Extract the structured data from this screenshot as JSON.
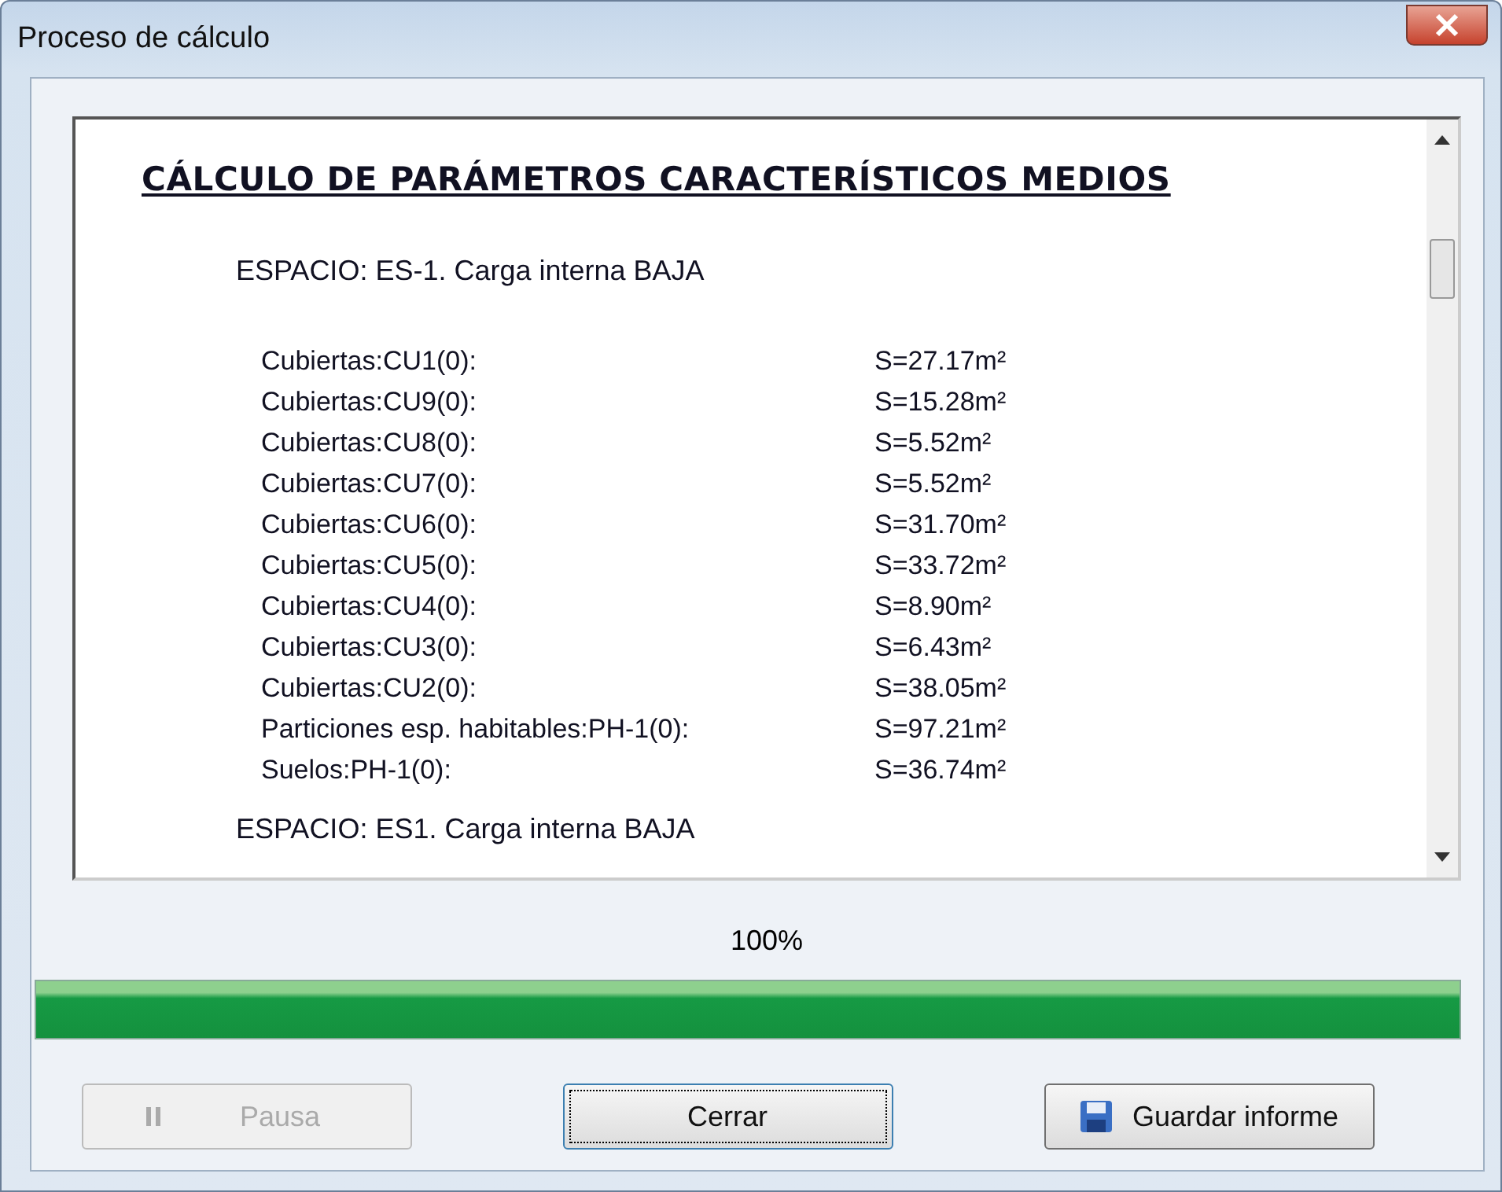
{
  "window": {
    "title": "Proceso de cálculo"
  },
  "report": {
    "heading": "CÁLCULO DE PARÁMETROS CARACTERÍSTICOS MEDIOS",
    "sections": [
      {
        "title": "ESPACIO: ES-1. Carga interna BAJA",
        "rows": [
          {
            "element": "Cubiertas:CU1(0):",
            "area": "S=27.17m²"
          },
          {
            "element": "Cubiertas:CU9(0):",
            "area": "S=15.28m²"
          },
          {
            "element": "Cubiertas:CU8(0):",
            "area": "S=5.52m²"
          },
          {
            "element": "Cubiertas:CU7(0):",
            "area": "S=5.52m²"
          },
          {
            "element": "Cubiertas:CU6(0):",
            "area": "S=31.70m²"
          },
          {
            "element": "Cubiertas:CU5(0):",
            "area": "S=33.72m²"
          },
          {
            "element": "Cubiertas:CU4(0):",
            "area": "S=8.90m²"
          },
          {
            "element": "Cubiertas:CU3(0):",
            "area": "S=6.43m²"
          },
          {
            "element": "Cubiertas:CU2(0):",
            "area": "S=38.05m²"
          },
          {
            "element": "Particiones esp. habitables:PH-1(0):",
            "area": "S=97.21m²"
          },
          {
            "element": "Suelos:PH-1(0):",
            "area": "S=36.74m²"
          }
        ]
      },
      {
        "title": "ESPACIO: ES1. Carga interna BAJA"
      }
    ]
  },
  "progress": {
    "reading": "100%",
    "level": 1
  },
  "buttons": [
    {
      "label": "Pausa",
      "kind": "pause",
      "disabled": true,
      "focused": false
    },
    {
      "label": "Cerrar",
      "kind": "plain",
      "disabled": false,
      "focused": true
    },
    {
      "label": "Guardar informe",
      "kind": "save",
      "disabled": false,
      "focused": false
    }
  ]
}
